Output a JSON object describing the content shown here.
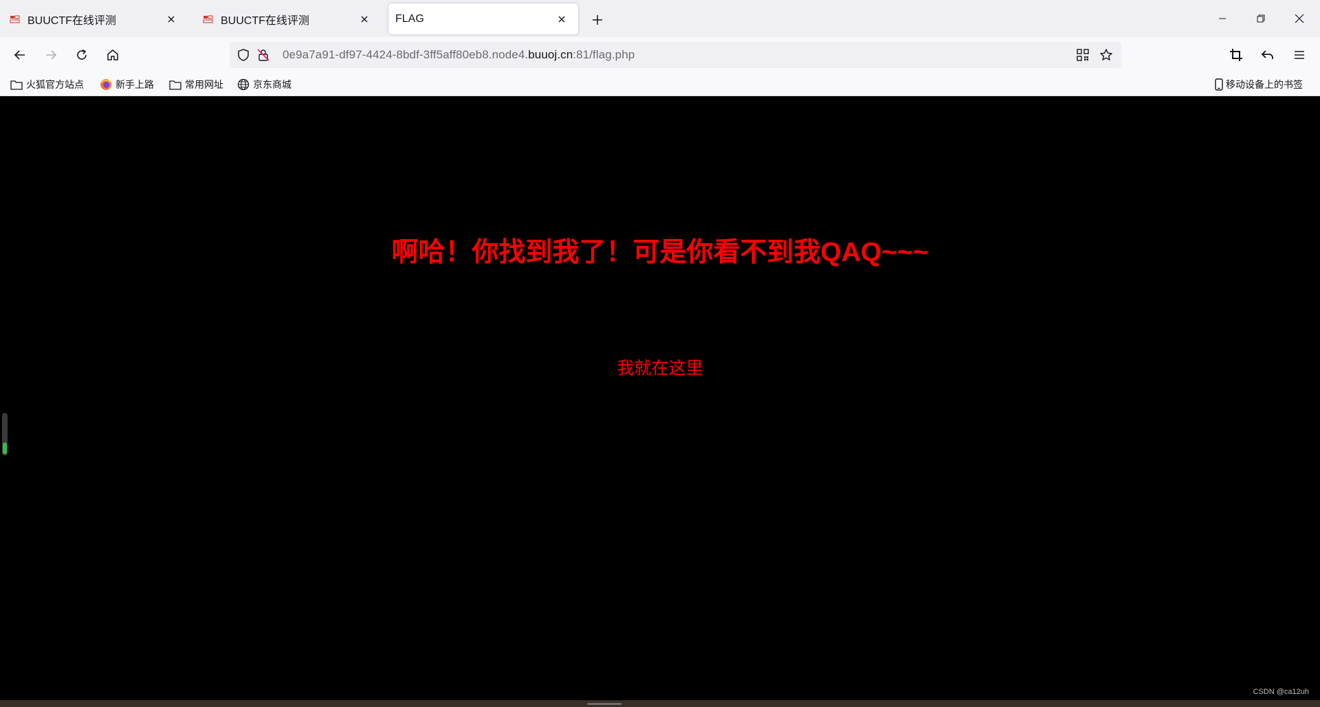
{
  "browser": {
    "tabs": [
      {
        "title": "BUUCTF在线评测",
        "active": false,
        "favicon": "buuctf-favicon-icon"
      },
      {
        "title": "BUUCTF在线评测",
        "active": false,
        "favicon": "buuctf-favicon-icon"
      },
      {
        "title": "FLAG",
        "active": true,
        "favicon": ""
      }
    ],
    "new_tab_icon": "plus-icon",
    "window_controls": [
      "minimize-icon",
      "restore-icon",
      "close-icon"
    ]
  },
  "navbar": {
    "url_prefix": "0e9a7a91-df97-4424-8bdf-3ff5aff80eb8.node4.",
    "url_domain": "buuoj.cn",
    "url_suffix": ":81/flag.php",
    "icons": [
      "back-arrow-icon",
      "forward-arrow-icon",
      "reload-icon",
      "home-icon",
      "shield-icon",
      "insecure-lock-icon",
      "qr-code-icon",
      "star-icon",
      "crop-icon",
      "undo-icon",
      "menu-icon"
    ]
  },
  "bookmarks": {
    "items": [
      {
        "label": "火狐官方站点",
        "icon": "folder-icon"
      },
      {
        "label": "新手上路",
        "icon": "firefox-icon"
      },
      {
        "label": "常用网址",
        "icon": "folder-icon"
      },
      {
        "label": "京东商城",
        "icon": "globe-icon"
      }
    ],
    "mobile": {
      "label": "移动设备上的书签",
      "icon": "mobile-icon"
    }
  },
  "page": {
    "headline": "啊哈！你找到我了！可是你看不到我QAQ~~~",
    "link_text": "我就在这里",
    "text_color": "#ff0000",
    "background": "#000000"
  },
  "watermark": "CSDN @ca12uh",
  "colors": {
    "tabstrip_bg": "#f0f0f4",
    "toolbar_bg": "#f9f9fb",
    "side_indicator": "#2fbf4a"
  },
  "side_indicator_level": 0.3
}
